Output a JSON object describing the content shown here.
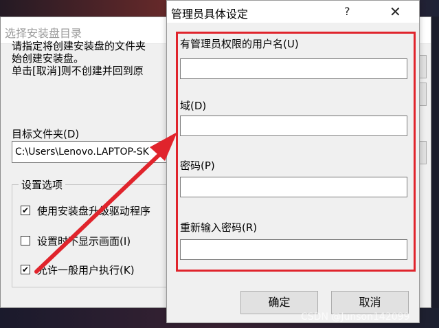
{
  "back_window": {
    "title": "选择安装盘目录",
    "description": "请指定将创建安装盘的文件夹\n始创建安装盘。\n单击[取消]则不创建并回到原",
    "target_label": "目标文件夹(D)",
    "target_path": "C:\\Users\\Lenovo.LAPTOP-SK",
    "group_title": "设置选项",
    "options": [
      {
        "label": "使用安装盘升级驱动程序",
        "checked": true
      },
      {
        "label": "设置时不显示画面(I)",
        "checked": false
      },
      {
        "label": "允许一般用户执行(K)",
        "checked": true
      }
    ]
  },
  "dialog": {
    "title": "管理员具体设定",
    "help_glyph": "?",
    "close_glyph": "✕",
    "fields": [
      {
        "label": "有管理员权限的用户名(U)",
        "value": ""
      },
      {
        "label": "域(D)",
        "value": ""
      },
      {
        "label": "密码(P)",
        "value": ""
      },
      {
        "label": "重新输入密码(R)",
        "value": ""
      }
    ],
    "ok_label": "确定",
    "cancel_label": "取消"
  },
  "annotation": {
    "highlight_color": "#e0242c"
  },
  "watermark": "CSDN @Junson142099"
}
